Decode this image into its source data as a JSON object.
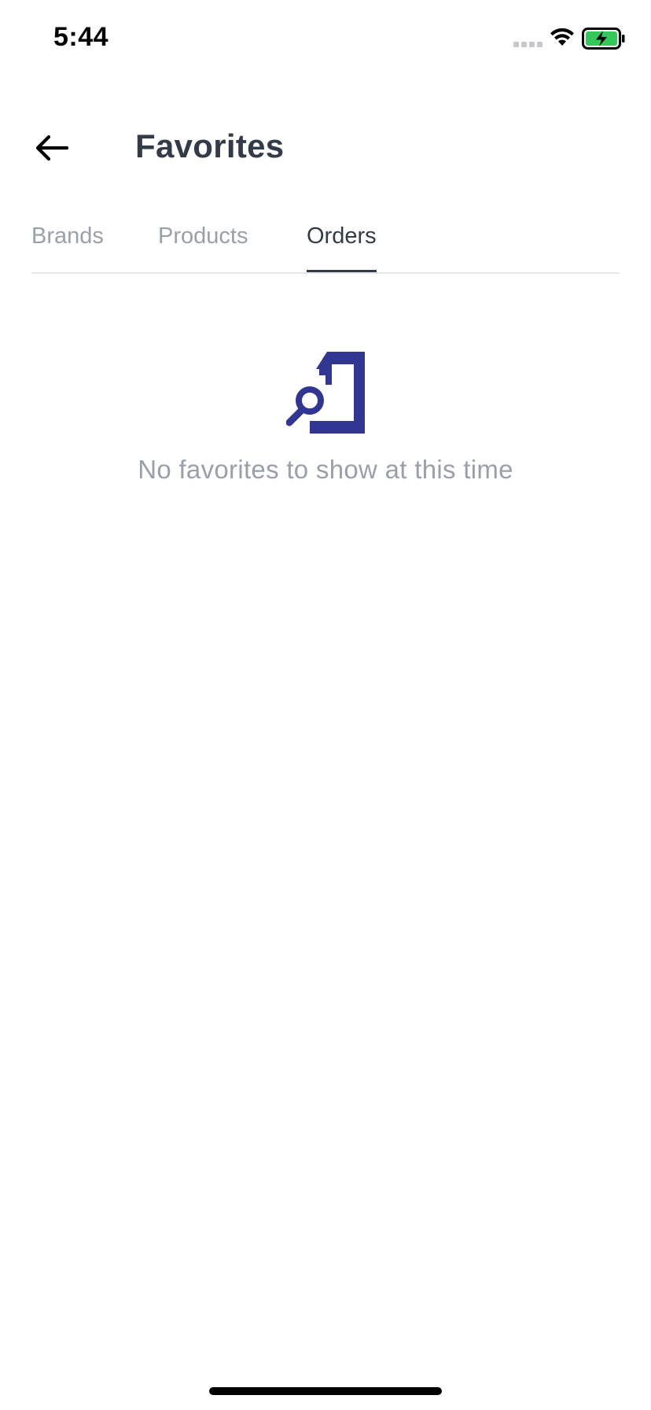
{
  "status_bar": {
    "time": "5:44"
  },
  "header": {
    "title": "Favorites",
    "back_icon": "arrow-left-icon"
  },
  "tabs": [
    {
      "label": "Brands",
      "active": false
    },
    {
      "label": "Products",
      "active": false
    },
    {
      "label": "Orders",
      "active": true
    }
  ],
  "empty_state": {
    "icon": "document-search-icon",
    "message": "No favorites to show at this time"
  },
  "colors": {
    "title_text": "#343b48",
    "inactive_tab": "#9aa0ab",
    "active_tab": "#343b48",
    "icon_accent": "#323693",
    "battery_fill": "#34c759",
    "divider": "#e5e7eb"
  }
}
